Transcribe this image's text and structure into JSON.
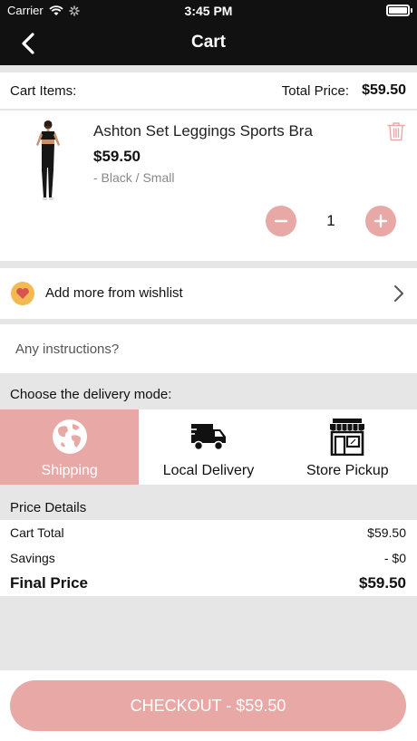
{
  "status_bar": {
    "carrier": "Carrier",
    "time": "3:45 PM"
  },
  "nav": {
    "title": "Cart",
    "back_icon": "chevron-left-icon"
  },
  "cart_header": {
    "items_label": "Cart Items:",
    "total_label": "Total Price:",
    "total_value": "$59.50"
  },
  "cart_items": [
    {
      "name": "Ashton Set Leggings Sports Bra",
      "price": "$59.50",
      "variant": "- Black / Small",
      "quantity": "1"
    }
  ],
  "wishlist": {
    "label": "Add more from wishlist"
  },
  "instructions": {
    "placeholder": "Any instructions?"
  },
  "delivery": {
    "title": "Choose the delivery mode:",
    "modes": [
      {
        "label": "Shipping",
        "icon": "globe-icon",
        "selected": true
      },
      {
        "label": "Local Delivery",
        "icon": "truck-icon",
        "selected": false
      },
      {
        "label": "Store Pickup",
        "icon": "store-icon",
        "selected": false
      }
    ]
  },
  "price_details": {
    "title": "Price Details",
    "rows": [
      {
        "label": "Cart Total",
        "value": "$59.50"
      },
      {
        "label": "Savings",
        "value": "- $0"
      },
      {
        "label": "Final Price",
        "value": "$59.50"
      }
    ]
  },
  "checkout": {
    "label": "CHECKOUT - $59.50"
  },
  "colors": {
    "accent": "#e8a9a6",
    "header_bg": "#111111",
    "heart_badge": "#f3b953"
  }
}
